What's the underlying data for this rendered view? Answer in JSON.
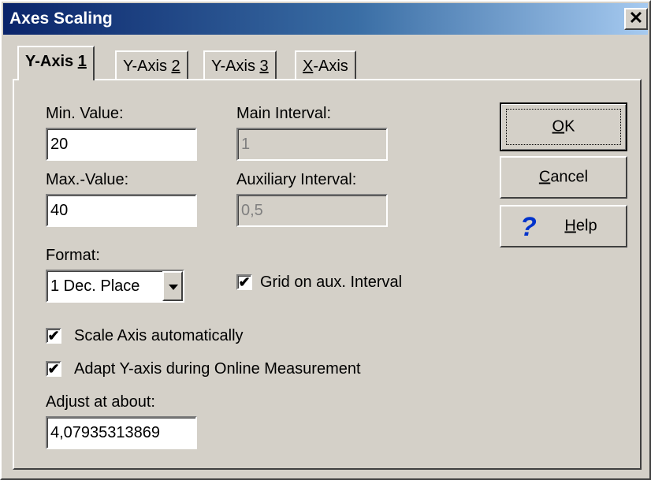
{
  "window": {
    "title": "Axes Scaling",
    "close_glyph": "✕",
    "close_icon": "close-icon"
  },
  "tabs": [
    {
      "prefix": "Y-Axis ",
      "accel": "1",
      "suffix": "",
      "active": true
    },
    {
      "prefix": "Y-Axis ",
      "accel": "2",
      "suffix": "",
      "active": false
    },
    {
      "prefix": "Y-Axis ",
      "accel": "3",
      "suffix": "",
      "active": false
    },
    {
      "prefix": "",
      "accel": "X",
      "suffix": "-Axis",
      "active": false
    }
  ],
  "fields": {
    "min_label": "Min. Value:",
    "min_value": "20",
    "max_label": "Max.-Value:",
    "max_value": "40",
    "main_interval_label": "Main Interval:",
    "main_interval_value": "1",
    "aux_interval_label": "Auxiliary Interval:",
    "aux_interval_value": "0,5",
    "format_label": "Format:",
    "format_selected": "1 Dec. Place",
    "adjust_label": "Adjust at about:",
    "adjust_value": "4,07935313869"
  },
  "checkboxes": {
    "grid_aux": {
      "label": "Grid on aux. Interval",
      "checked": true
    },
    "scale_auto": {
      "label": "Scale Axis automatically",
      "checked": true
    },
    "adapt_online": {
      "label": "Adapt Y-axis during Online Measurement",
      "checked": true
    }
  },
  "check_glyph": "✔",
  "buttons": {
    "ok": {
      "accel": "O",
      "rest": "K"
    },
    "cancel": {
      "accel": "C",
      "rest": "ancel"
    },
    "help": {
      "accel": "H",
      "rest": "elp",
      "icon_glyph": "?",
      "icon": "question-mark-icon"
    }
  },
  "colors": {
    "title_bar": "#0a246a",
    "face": "#d4d0c8",
    "help_icon": "#0033cc"
  }
}
